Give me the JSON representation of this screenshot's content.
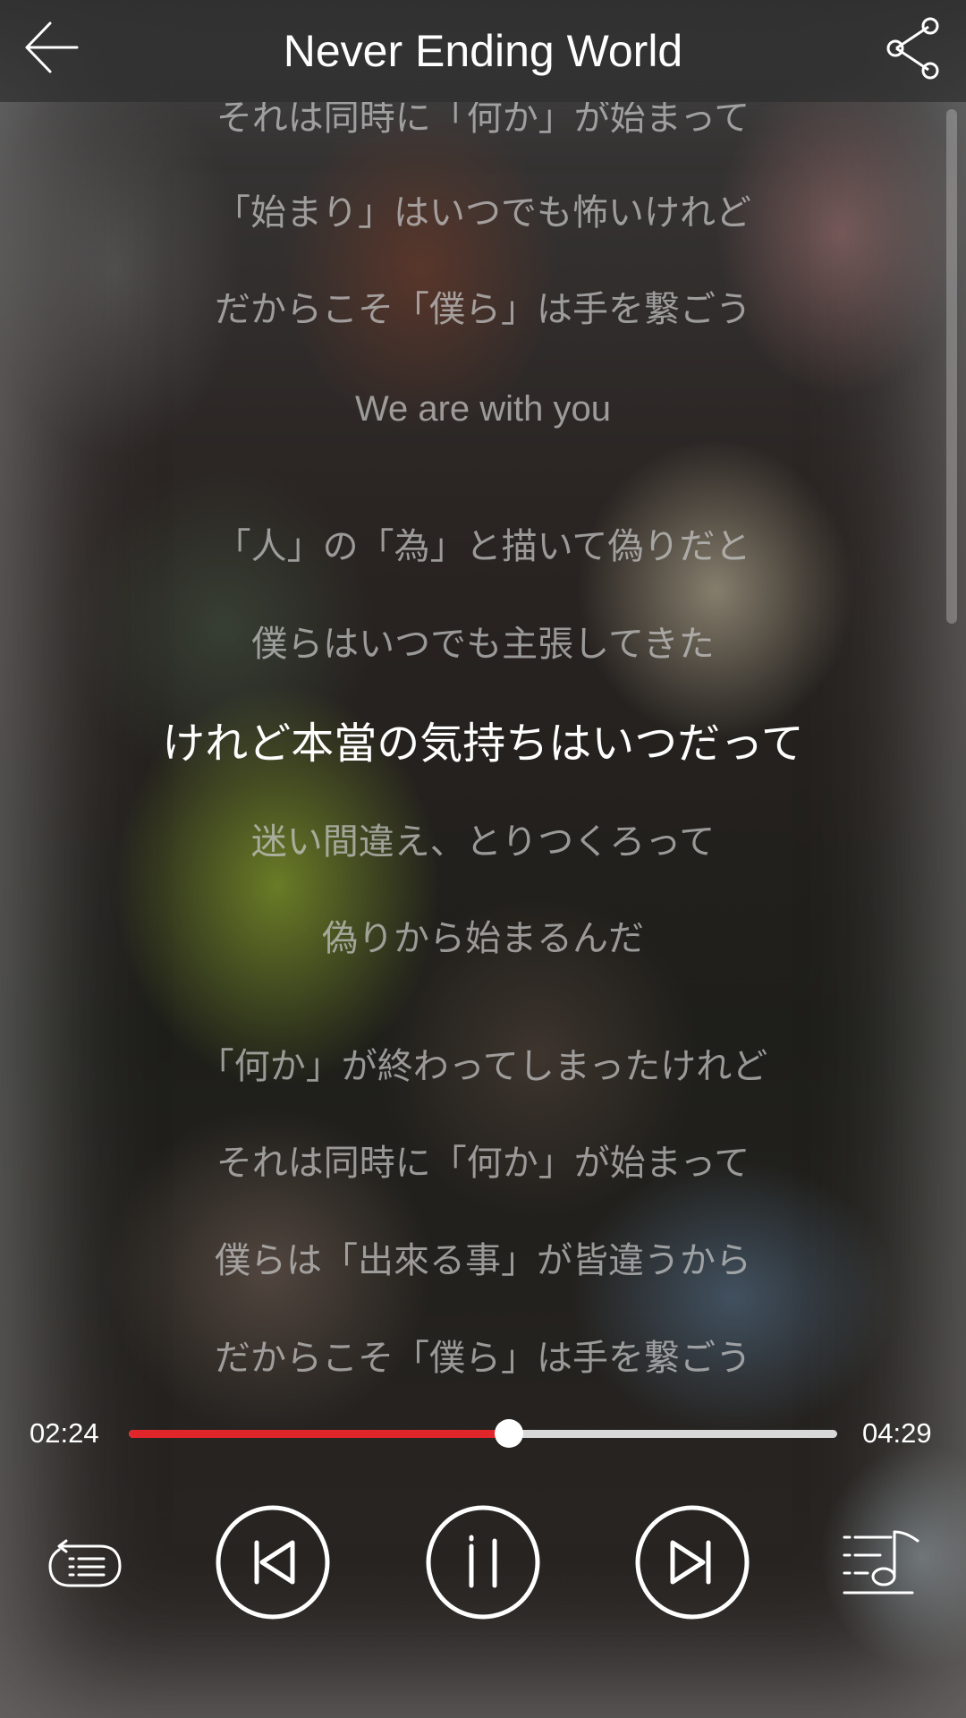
{
  "header": {
    "title": "Never Ending World",
    "back_icon": "arrow-left-icon",
    "share_icon": "share-icon"
  },
  "lyrics": {
    "lines": [
      "それは同時に「何か」が始まって",
      "「始まり」はいつでも怖いけれど",
      "だからこそ「僕ら」は手を繋ごう",
      "We are with you",
      "「人」の「為」と描いて偽りだと",
      "僕らはいつでも主張してきた",
      "けれど本當の気持ちはいつだって",
      "迷い間違え、とりつくろって",
      "偽りから始まるんだ",
      "「何か」が終わってしまったけれど",
      "それは同時に「何か」が始まって",
      "僕らは「出來る事」が皆違うから",
      "だからこそ「僕ら」は手を繋ごう"
    ],
    "current_index": 6
  },
  "player": {
    "elapsed": "02:24",
    "total": "04:29",
    "progress_fraction": 0.536,
    "accent_color": "#e0262b",
    "controls": {
      "repeat_icon": "playlist-repeat-icon",
      "previous_icon": "skip-previous-icon",
      "pause_icon": "pause-icon",
      "next_icon": "skip-next-icon",
      "lyrics_icon": "lyrics-note-icon"
    }
  }
}
